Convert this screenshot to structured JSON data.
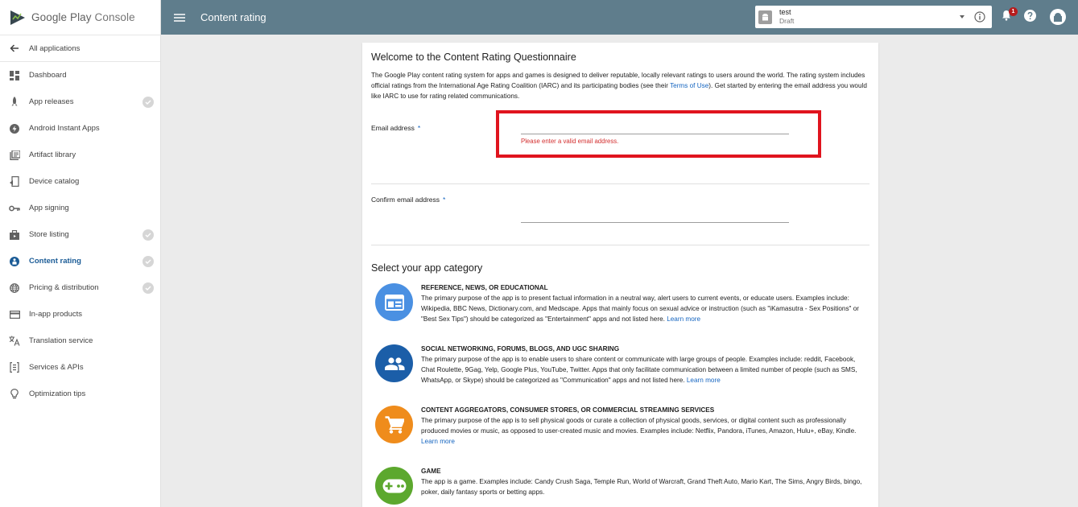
{
  "brand": {
    "name_part1": "Google Play",
    "name_part2": "Console"
  },
  "sidebar": {
    "back_label": "All applications",
    "items": [
      {
        "label": "Dashboard",
        "icon": "dashboard-icon",
        "checked": false,
        "active": false
      },
      {
        "label": "App releases",
        "icon": "rocket-icon",
        "checked": true,
        "active": false
      },
      {
        "label": "Android Instant Apps",
        "icon": "bolt-icon",
        "checked": false,
        "active": false
      },
      {
        "label": "Artifact library",
        "icon": "library-icon",
        "checked": false,
        "active": false
      },
      {
        "label": "Device catalog",
        "icon": "device-icon",
        "checked": false,
        "active": false
      },
      {
        "label": "App signing",
        "icon": "key-icon",
        "checked": false,
        "active": false
      },
      {
        "label": "Store listing",
        "icon": "store-icon",
        "checked": true,
        "active": false
      },
      {
        "label": "Content rating",
        "icon": "content-rating-icon",
        "checked": true,
        "active": true
      },
      {
        "label": "Pricing & distribution",
        "icon": "globe-icon",
        "checked": true,
        "active": false
      },
      {
        "label": "In-app products",
        "icon": "card-icon",
        "checked": false,
        "active": false
      },
      {
        "label": "Translation service",
        "icon": "translate-icon",
        "checked": false,
        "active": false
      },
      {
        "label": "Services & APIs",
        "icon": "api-icon",
        "checked": false,
        "active": false
      },
      {
        "label": "Optimization tips",
        "icon": "lightbulb-icon",
        "checked": false,
        "active": false
      }
    ]
  },
  "header": {
    "title": "Content rating",
    "app_selector": {
      "name": "test",
      "status": "Draft"
    },
    "notification_count": "1"
  },
  "questionnaire": {
    "title": "Welcome to the Content Rating Questionnaire",
    "intro_before": "The Google Play content rating system for apps and games is designed to deliver reputable, locally relevant ratings to users around the world. The rating system includes official ratings from the International Age Rating Coalition (IARC) and its participating bodies (see their ",
    "intro_link": "Terms of Use",
    "intro_after": "). Get started by entering the email address you would like IARC to use for rating related communications.",
    "email_label": "Email address",
    "confirm_label": "Confirm email address",
    "required_mark": "*",
    "email_value": "",
    "confirm_value": "",
    "email_error": "Please enter a valid email address.",
    "category_section_title": "Select your app category",
    "learn_more": "Learn more",
    "categories": [
      {
        "title": "REFERENCE, NEWS, OR EDUCATIONAL",
        "description": "The primary purpose of the app is to present factual information in a neutral way, alert users to current events, or educate users. Examples include: Wikipedia, BBC News, Dictionary.com, and Medscape. Apps that mainly focus on sexual advice or instruction (such as \"iKamasutra - Sex Positions\" or \"Best Sex Tips\") should be categorized as \"Entertainment\" apps and not listed here.",
        "color": "#4a90e2",
        "icon": "reference-icon"
      },
      {
        "title": "SOCIAL NETWORKING, FORUMS, BLOGS, AND UGC SHARING",
        "description": "The primary purpose of the app is to enable users to share content or communicate with large groups of people. Examples include: reddit, Facebook, Chat Roulette, 9Gag, Yelp, Google Plus, YouTube, Twitter. Apps that only facilitate communication between a limited number of people (such as SMS, WhatsApp, or Skype) should be categorized as \"Communication\" apps and not listed here.",
        "color": "#1b5ea8",
        "icon": "people-icon"
      },
      {
        "title": "CONTENT AGGREGATORS, CONSUMER STORES, OR COMMERCIAL STREAMING SERVICES",
        "description": "The primary purpose of the app is to sell physical goods or curate a collection of physical goods, services, or digital content such as professionally produced movies or music, as opposed to user-created music and movies. Examples include: Netflix, Pandora, iTunes, Amazon, Hulu+, eBay, Kindle.",
        "color": "#ef8c1c",
        "icon": "cart-icon"
      },
      {
        "title": "GAME",
        "description": "The app is a game. Examples include: Candy Crush Saga, Temple Run, World of Warcraft, Grand Theft Auto, Mario Kart, The Sims, Angry Birds, bingo, poker, daily fantasy sports or betting apps.",
        "color": "#5ca82e",
        "icon": "gamepad-icon"
      }
    ]
  }
}
